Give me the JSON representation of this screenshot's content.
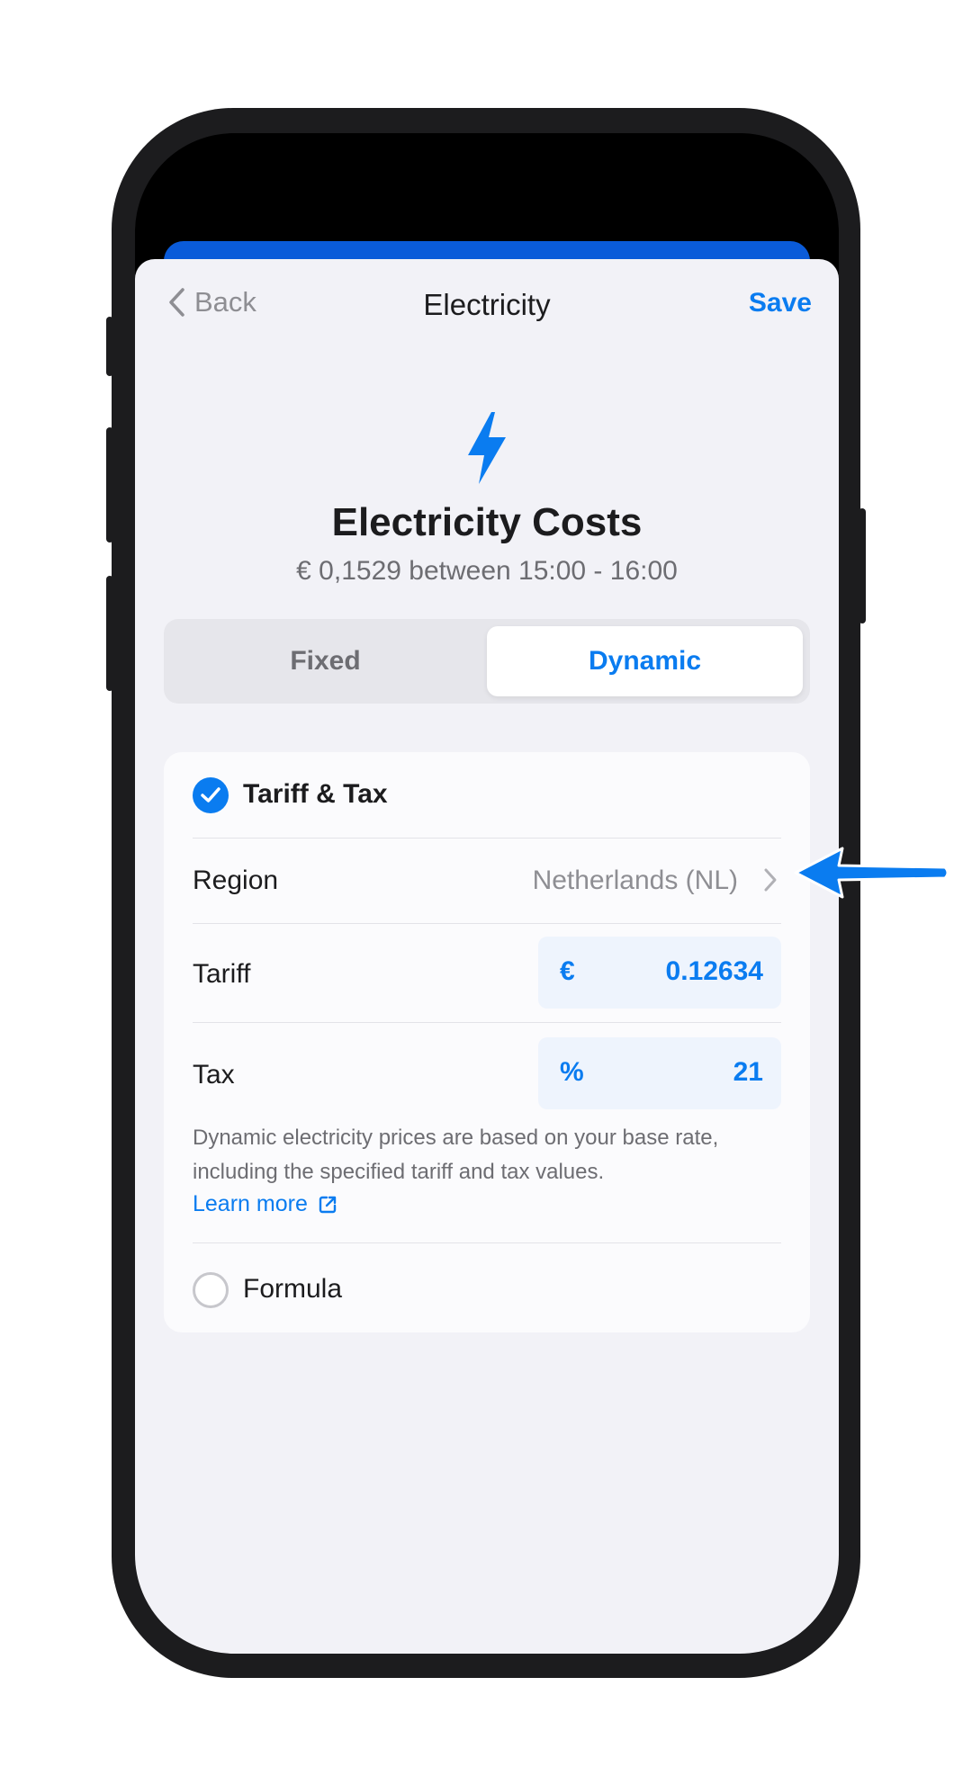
{
  "nav": {
    "back_label": "Back",
    "title": "Electricity",
    "save_label": "Save"
  },
  "hero": {
    "icon": "lightning-bolt-icon",
    "title": "Electricity Costs",
    "subtitle": "€ 0,1529 between 15:00 - 16:00"
  },
  "segment": {
    "options": [
      "Fixed",
      "Dynamic"
    ],
    "selected": "Dynamic"
  },
  "tariff_tax": {
    "title": "Tariff & Tax",
    "checked": true,
    "region": {
      "label": "Region",
      "value": "Netherlands (NL)"
    },
    "tariff": {
      "label": "Tariff",
      "unit": "€",
      "value": "0.12634"
    },
    "tax": {
      "label": "Tax",
      "unit": "%",
      "value": "21"
    },
    "description": "Dynamic electricity prices are based on your base rate, including the specified tariff and tax values.",
    "learn_more": "Learn more"
  },
  "formula": {
    "label": "Formula",
    "checked": false
  },
  "colors": {
    "accent": "#0a7cf0",
    "background": "#f2f2f7",
    "frame": "#1c1c1e"
  }
}
